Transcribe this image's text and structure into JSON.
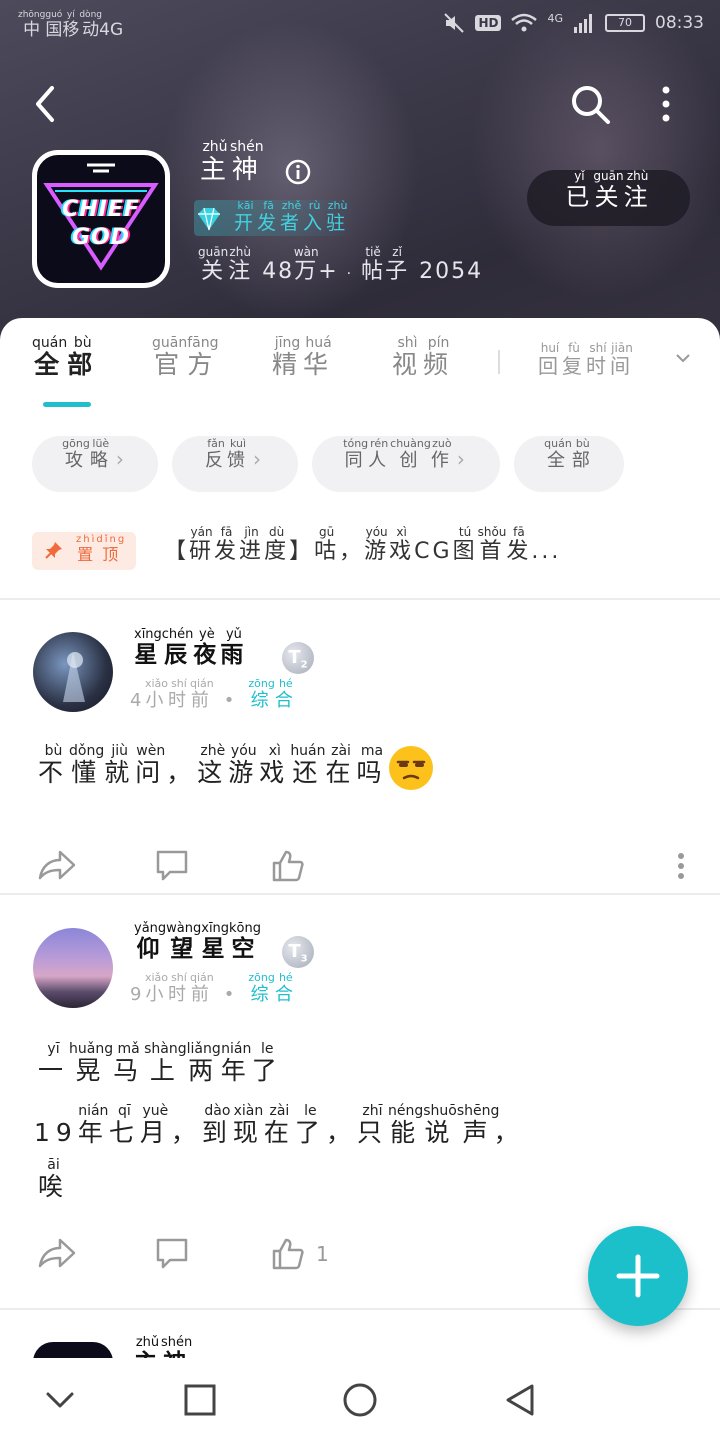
{
  "status_bar": {
    "carrier": [
      "中",
      "国",
      "移",
      "动"
    ],
    "carrier_pinyin": [
      "zhōng",
      "guó",
      "yí",
      "dòng"
    ],
    "network": "4G",
    "hd": "HD",
    "signal_type": "4G",
    "battery": "70",
    "time": "08:33"
  },
  "header": {
    "logo_line1": "CHIEF",
    "logo_line2": "GOD",
    "name": [
      "主",
      "神"
    ],
    "name_pinyin": [
      "zhǔ",
      "shén"
    ],
    "dev_tag": [
      "开",
      "发",
      "者",
      "入",
      "驻"
    ],
    "dev_tag_pinyin": [
      "kāi",
      "fā",
      "zhě",
      "rù",
      "zhù"
    ],
    "stats_follow_label": [
      "关",
      "注"
    ],
    "stats_follow_pinyin": [
      "guān",
      "zhù"
    ],
    "stats_follow_value_a": "48",
    "stats_follow_wan": "万",
    "stats_follow_wan_pinyin": "wàn",
    "stats_follow_value_b": "+",
    "stats_dot": "·",
    "stats_post_label": [
      "帖",
      "子"
    ],
    "stats_post_pinyin": [
      "tiě",
      "zǐ"
    ],
    "stats_post_value": "2054",
    "follow_button": [
      "已",
      "关",
      "注"
    ],
    "follow_button_pinyin": [
      "yǐ",
      "guān",
      "zhù"
    ]
  },
  "tabs": [
    {
      "chars": [
        "全",
        "部"
      ],
      "pinyin": [
        "quán",
        "bù"
      ],
      "active": true
    },
    {
      "chars": [
        "官",
        "方"
      ],
      "pinyin": [
        "guān",
        "fāng"
      ],
      "active": false
    },
    {
      "chars": [
        "精",
        "华"
      ],
      "pinyin": [
        "jīng",
        "huá"
      ],
      "active": false
    },
    {
      "chars": [
        "视",
        "频"
      ],
      "pinyin": [
        "shì",
        "pín"
      ],
      "active": false
    }
  ],
  "sort": {
    "chars": [
      "回",
      "复",
      "时",
      "间"
    ],
    "pinyin": [
      "huí",
      "fù",
      "shí",
      "jiān"
    ]
  },
  "chips": [
    {
      "chars": [
        "攻",
        "略"
      ],
      "pinyin": [
        "gōng",
        "lüè"
      ],
      "chevron": "›"
    },
    {
      "chars": [
        "反",
        "馈"
      ],
      "pinyin": [
        "fǎn",
        "kuì"
      ],
      "chevron": "›"
    },
    {
      "chars": [
        "同",
        "人",
        "创",
        "作"
      ],
      "pinyin": [
        "tóng",
        "rén",
        "chuàng",
        "zuò"
      ],
      "chevron": "›"
    },
    {
      "chars": [
        "全",
        "部"
      ],
      "pinyin": [
        "quán",
        "bù"
      ],
      "chevron": ""
    }
  ],
  "pinned": {
    "badge": [
      "置",
      "顶"
    ],
    "badge_pinyin": [
      "zhì",
      "dǐng"
    ],
    "title_open": "【",
    "title_a": [
      "研",
      "发",
      "进",
      "度"
    ],
    "title_a_pinyin": [
      "yán",
      "fā",
      "jìn",
      "dù"
    ],
    "title_close": "】",
    "title_b": [
      "咕"
    ],
    "title_b_pinyin": [
      "gū"
    ],
    "title_comma": "，",
    "title_c": [
      "游",
      "戏"
    ],
    "title_c_pinyin": [
      "yóu",
      "xì"
    ],
    "title_cg": "CG",
    "title_d": [
      "图",
      "首",
      "发"
    ],
    "title_d_pinyin": [
      "tú",
      "shǒu",
      "fā"
    ],
    "title_ellipsis": "..."
  },
  "posts": [
    {
      "username": [
        "星",
        "辰",
        "夜",
        "雨"
      ],
      "username_pinyin": [
        "xīng",
        "chén",
        "yè",
        "yǔ"
      ],
      "level_letter": "T",
      "level_num": "2",
      "time_num": "4",
      "time_chars": [
        "小",
        "时",
        "前"
      ],
      "time_pinyin": [
        "xiǎo",
        "shí",
        "qián"
      ],
      "category": [
        "综",
        "合"
      ],
      "category_pinyin": [
        "zōng",
        "hé"
      ],
      "body_a": [
        "不",
        "懂",
        "就",
        "问"
      ],
      "body_a_pinyin": [
        "bù",
        "dǒng",
        "jiù",
        "wèn"
      ],
      "body_comma": "，",
      "body_b": [
        "这",
        "游",
        "戏",
        "还",
        "在",
        "吗"
      ],
      "body_b_pinyin": [
        "zhè",
        "yóu",
        "xì",
        "huán",
        "zài",
        "ma"
      ],
      "likes": ""
    },
    {
      "username": [
        "仰",
        "望",
        "星",
        "空"
      ],
      "username_pinyin": [
        "yǎng",
        "wàng",
        "xīng",
        "kōng"
      ],
      "level_letter": "T",
      "level_num": "3",
      "time_num": "9",
      "time_chars": [
        "小",
        "时",
        "前"
      ],
      "time_pinyin": [
        "xiǎo",
        "shí",
        "qián"
      ],
      "category": [
        "综",
        "合"
      ],
      "category_pinyin": [
        "zōng",
        "hé"
      ],
      "line1": [
        "一",
        "晃",
        "马",
        "上",
        "两",
        "年",
        "了"
      ],
      "line1_pinyin": [
        "yī",
        "huǎng",
        "mǎ",
        "shàng",
        "liǎng",
        "nián",
        "le"
      ],
      "line2_num": "19",
      "line2_a": [
        "年",
        "七",
        "月"
      ],
      "line2_a_pinyin": [
        "nián",
        "qī",
        "yuè"
      ],
      "line2_b": [
        "到",
        "现",
        "在",
        "了"
      ],
      "line2_b_pinyin": [
        "dào",
        "xiàn",
        "zài",
        "le"
      ],
      "line2_c": [
        "只",
        "能",
        "说",
        "声"
      ],
      "line2_c_pinyin": [
        "zhī",
        "néng",
        "shuō",
        "shēng"
      ],
      "comma": "，",
      "line3": [
        "唉"
      ],
      "line3_pinyin": [
        "āi"
      ],
      "likes": "1"
    },
    {
      "username": [
        "主",
        "神"
      ],
      "username_pinyin": [
        "zhǔ",
        "shén"
      ]
    }
  ],
  "colors": {
    "accent": "#21bfcc",
    "pin": "#f06a3c",
    "header_bg": "#3b3848"
  },
  "icons": [
    "back-arrow-icon",
    "search-icon",
    "more-vertical-icon",
    "info-icon",
    "diamond-icon",
    "chevron-down-icon",
    "pin-icon",
    "share-icon",
    "comment-icon",
    "like-icon",
    "plus-icon",
    "nav-back-icon",
    "nav-home-icon",
    "nav-recents-icon"
  ]
}
